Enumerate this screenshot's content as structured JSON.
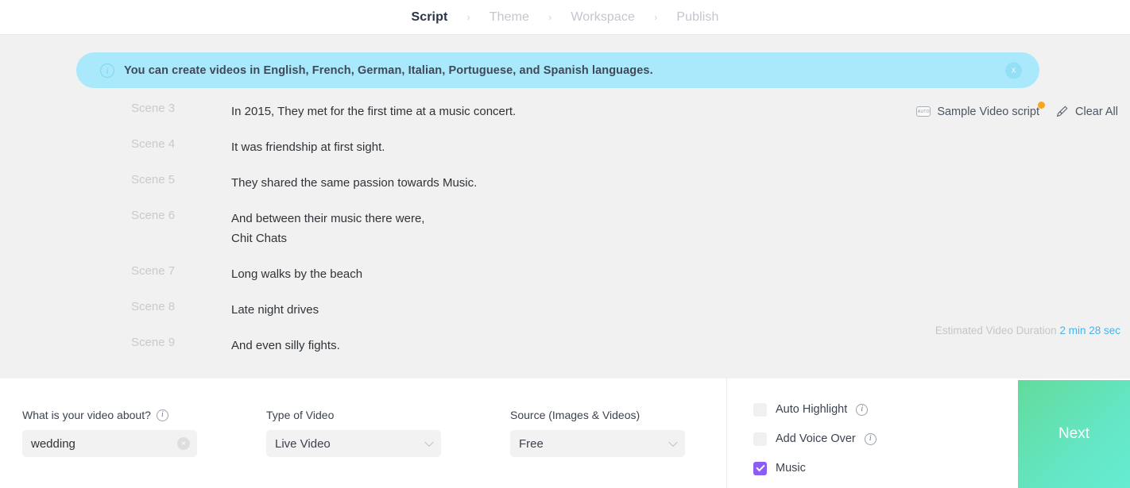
{
  "breadcrumb": {
    "separator": "›",
    "items": [
      {
        "label": "Script",
        "active": true
      },
      {
        "label": "Theme",
        "active": false
      },
      {
        "label": "Workspace",
        "active": false
      },
      {
        "label": "Publish",
        "active": false
      }
    ]
  },
  "banner": {
    "icon": "info-icon",
    "message": "You can create videos in English, French, German, Italian, Portuguese, and Spanish languages.",
    "close_label": "x",
    "background_color": "#aae9fb"
  },
  "script_tools": {
    "sample_badge": "AUTO",
    "sample_label": "Sample Video script",
    "new_dot_color": "#f5a623",
    "clear_label": "Clear All"
  },
  "scenes": [
    {
      "label": "Scene 3",
      "text": "In 2015, They met for the first time at a music concert."
    },
    {
      "label": "Scene 4",
      "text": "It was friendship at first sight."
    },
    {
      "label": "Scene 5",
      "text": "They shared the same passion towards Music."
    },
    {
      "label": "Scene 6",
      "text": "And between their music there were,\nChit Chats"
    },
    {
      "label": "Scene 7",
      "text": "Long walks by the beach"
    },
    {
      "label": "Scene 8",
      "text": "Late night drives"
    },
    {
      "label": "Scene 9",
      "text": "And even silly fights."
    }
  ],
  "duration": {
    "label": "Estimated Video Duration",
    "value": "2 min 28 sec",
    "value_color": "#4bb3e8"
  },
  "form": {
    "topic": {
      "label": "What is your video about?",
      "value": "wedding",
      "placeholder": "What is your video about?",
      "clear_label": "×",
      "has_info": true
    },
    "video_type": {
      "label": "Type of Video",
      "value": "Live Video",
      "options": [
        "Live Video"
      ]
    },
    "source": {
      "label": "Source (Images & Videos)",
      "value": "Free",
      "options": [
        "Free"
      ]
    }
  },
  "options": [
    {
      "label": "Auto Highlight",
      "checked": false,
      "has_info": true
    },
    {
      "label": "Add Voice Over",
      "checked": false,
      "has_info": true
    },
    {
      "label": "Music",
      "checked": true,
      "has_info": false
    }
  ],
  "next_button": {
    "label": "Next",
    "gradient_from": "#62db9b",
    "gradient_to": "#65ecd2"
  }
}
